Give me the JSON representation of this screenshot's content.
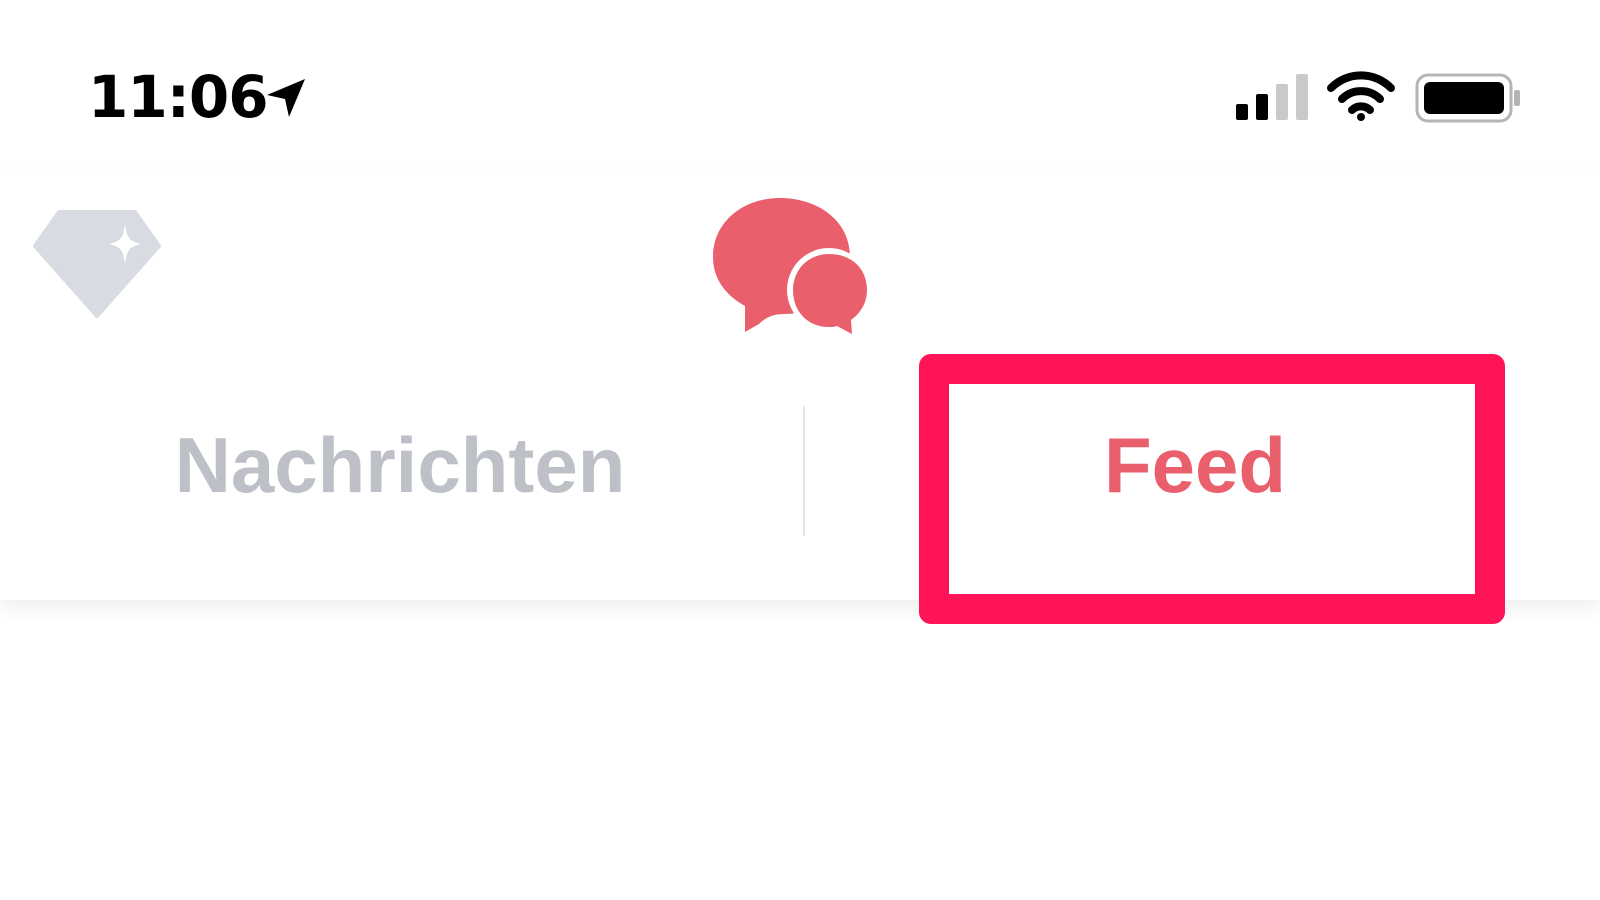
{
  "status_bar": {
    "time": "11:06",
    "icons": [
      "location-arrow-icon",
      "cellular-signal-icon",
      "wifi-icon",
      "battery-icon"
    ]
  },
  "header": {
    "left_icon": "gem-icon",
    "center_icon": "chat-bubbles-icon",
    "tabs": [
      {
        "label": "Nachrichten",
        "active": false
      },
      {
        "label": "Feed",
        "active": true
      }
    ]
  },
  "colors": {
    "accent": "#e9606c",
    "inactive_tab": "#bdc0c7",
    "gem": "#d8dbe2",
    "highlight": "#ff1458"
  }
}
